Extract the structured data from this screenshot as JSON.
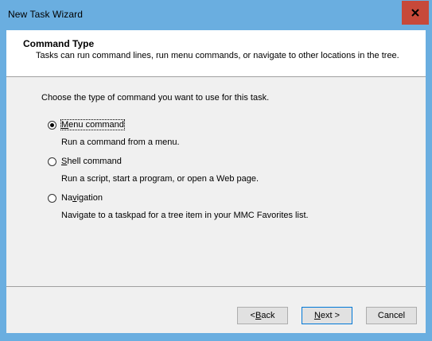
{
  "window": {
    "title": "New Task Wizard",
    "close_icon": "close-icon"
  },
  "header": {
    "title": "Command Type",
    "description": "Tasks can run command lines, run menu commands, or navigate to other locations in the tree."
  },
  "prompt": "Choose the type of command you want to use for this task.",
  "options": [
    {
      "label_pre": "",
      "label_mnemonic": "M",
      "label_post": "enu command",
      "description": "Run a command from a menu.",
      "checked": true
    },
    {
      "label_pre": "",
      "label_mnemonic": "S",
      "label_post": "hell command",
      "description": "Run a script, start a program, or open a Web page.",
      "checked": false
    },
    {
      "label_pre": "Na",
      "label_mnemonic": "v",
      "label_post": "igation",
      "description": "Navigate to a taskpad for a tree item in your MMC Favorites list.",
      "checked": false
    }
  ],
  "buttons": {
    "back_pre": "< ",
    "back_mnemonic": "B",
    "back_post": "ack",
    "next_pre": "",
    "next_mnemonic": "N",
    "next_post": "ext >",
    "cancel": "Cancel"
  },
  "colors": {
    "titlebar": "#6aaee0",
    "close_button": "#c7493a",
    "panel": "#f0f0f0",
    "default_button_border": "#0078d7"
  }
}
